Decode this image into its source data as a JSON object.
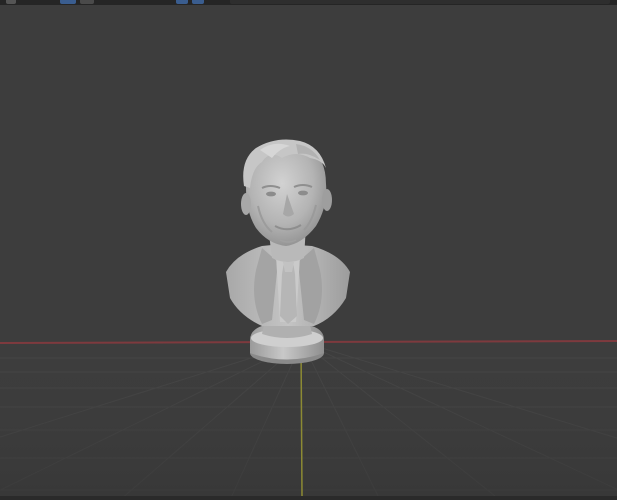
{
  "app": {
    "name": "3D viewport"
  },
  "header": {
    "icons": [
      "menu-icon",
      "view-mode-icon",
      "object-mode-icon",
      "shading-solid-icon",
      "shading-material-icon",
      "overlay-icon"
    ]
  },
  "viewport": {
    "background_color": "#3d3d3d",
    "grid_color": "#484848",
    "x_axis_color": "#8a3a3f",
    "y_axis_color": "#8c8a33",
    "object": {
      "name": "bust-sculpture-icon",
      "material_color": "#b8b8b8"
    }
  }
}
